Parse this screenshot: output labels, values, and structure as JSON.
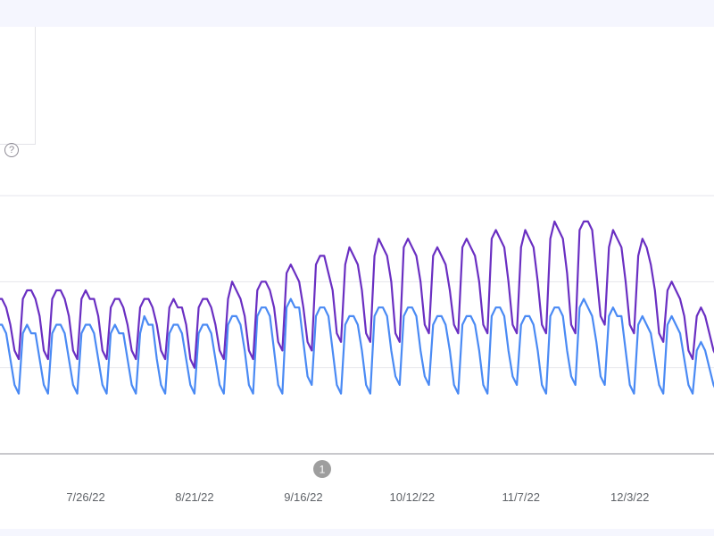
{
  "help_icon": "question-circle-icon",
  "annotation": {
    "label": "1",
    "date": "9/20/22"
  },
  "chart_data": {
    "type": "line",
    "x_start": "7/4/22",
    "x_end": "12/25/22",
    "frequency": "daily",
    "xlim": [
      "7/5/22",
      "12/24/22"
    ],
    "x_tick_labels": [
      "7/26/22",
      "8/21/22",
      "9/16/22",
      "10/12/22",
      "11/7/22",
      "12/3/22"
    ],
    "ylim": [
      0,
      3
    ],
    "y_gridlines": [
      1,
      2,
      3
    ],
    "grid": true,
    "colors": {
      "series_1": "#6a2fc2",
      "series_2": "#4a8af4"
    },
    "series": [
      {
        "values": [
          1.7,
          1.8,
          1.8,
          1.7,
          1.5,
          1.2,
          1.1,
          1.8,
          1.9,
          1.9,
          1.8,
          1.6,
          1.2,
          1.1,
          1.8,
          1.9,
          1.9,
          1.8,
          1.6,
          1.2,
          1.1,
          1.8,
          1.9,
          1.8,
          1.8,
          1.6,
          1.2,
          1.1,
          1.7,
          1.8,
          1.8,
          1.7,
          1.5,
          1.2,
          1.1,
          1.7,
          1.8,
          1.8,
          1.7,
          1.5,
          1.2,
          1.1,
          1.7,
          1.8,
          1.7,
          1.7,
          1.5,
          1.1,
          1.0,
          1.7,
          1.8,
          1.8,
          1.7,
          1.5,
          1.2,
          1.1,
          1.8,
          2.0,
          1.9,
          1.8,
          1.6,
          1.2,
          1.1,
          1.9,
          2.0,
          2.0,
          1.9,
          1.7,
          1.3,
          1.2,
          2.1,
          2.2,
          2.1,
          2.0,
          1.7,
          1.3,
          1.2,
          2.2,
          2.3,
          2.3,
          2.1,
          1.9,
          1.4,
          1.3,
          2.2,
          2.4,
          2.3,
          2.2,
          1.9,
          1.4,
          1.3,
          2.3,
          2.5,
          2.4,
          2.3,
          2.0,
          1.4,
          1.3,
          2.4,
          2.5,
          2.4,
          2.3,
          2.0,
          1.5,
          1.4,
          2.3,
          2.4,
          2.3,
          2.2,
          1.9,
          1.5,
          1.4,
          2.4,
          2.5,
          2.4,
          2.3,
          2.0,
          1.5,
          1.4,
          2.5,
          2.6,
          2.5,
          2.4,
          2.0,
          1.5,
          1.4,
          2.4,
          2.6,
          2.5,
          2.4,
          2.0,
          1.5,
          1.4,
          2.5,
          2.7,
          2.6,
          2.5,
          2.1,
          1.5,
          1.4,
          2.6,
          2.7,
          2.7,
          2.6,
          2.1,
          1.6,
          1.5,
          2.4,
          2.6,
          2.5,
          2.4,
          2.0,
          1.5,
          1.4,
          2.3,
          2.5,
          2.4,
          2.2,
          1.9,
          1.4,
          1.3,
          1.9,
          2.0,
          1.9,
          1.8,
          1.6,
          1.2,
          1.1,
          1.6,
          1.7,
          1.6,
          1.4,
          1.2,
          1.1,
          1.0
        ]
      },
      {
        "values": [
          1.4,
          1.5,
          1.5,
          1.4,
          1.1,
          0.8,
          0.7,
          1.4,
          1.5,
          1.4,
          1.4,
          1.1,
          0.8,
          0.7,
          1.4,
          1.5,
          1.5,
          1.4,
          1.1,
          0.8,
          0.7,
          1.4,
          1.5,
          1.5,
          1.4,
          1.1,
          0.8,
          0.7,
          1.4,
          1.5,
          1.4,
          1.4,
          1.1,
          0.8,
          0.7,
          1.4,
          1.6,
          1.5,
          1.5,
          1.1,
          0.8,
          0.7,
          1.4,
          1.5,
          1.5,
          1.4,
          1.1,
          0.8,
          0.7,
          1.4,
          1.5,
          1.5,
          1.4,
          1.1,
          0.8,
          0.7,
          1.5,
          1.6,
          1.6,
          1.5,
          1.2,
          0.8,
          0.7,
          1.6,
          1.7,
          1.7,
          1.6,
          1.2,
          0.8,
          0.7,
          1.7,
          1.8,
          1.7,
          1.7,
          1.3,
          0.9,
          0.8,
          1.6,
          1.7,
          1.7,
          1.6,
          1.2,
          0.8,
          0.7,
          1.5,
          1.6,
          1.6,
          1.5,
          1.2,
          0.8,
          0.7,
          1.6,
          1.7,
          1.7,
          1.6,
          1.2,
          0.9,
          0.8,
          1.6,
          1.7,
          1.7,
          1.6,
          1.2,
          0.9,
          0.8,
          1.5,
          1.6,
          1.6,
          1.5,
          1.2,
          0.8,
          0.7,
          1.5,
          1.6,
          1.6,
          1.5,
          1.2,
          0.8,
          0.7,
          1.6,
          1.7,
          1.7,
          1.6,
          1.2,
          0.9,
          0.8,
          1.5,
          1.6,
          1.6,
          1.5,
          1.2,
          0.8,
          0.7,
          1.6,
          1.7,
          1.7,
          1.6,
          1.2,
          0.9,
          0.8,
          1.7,
          1.8,
          1.7,
          1.6,
          1.3,
          0.9,
          0.8,
          1.6,
          1.7,
          1.6,
          1.6,
          1.2,
          0.8,
          0.7,
          1.5,
          1.6,
          1.5,
          1.4,
          1.1,
          0.8,
          0.7,
          1.5,
          1.6,
          1.5,
          1.4,
          1.1,
          0.8,
          0.7,
          1.2,
          1.3,
          1.2,
          1.0,
          0.8,
          0.7,
          0.6
        ]
      }
    ]
  }
}
